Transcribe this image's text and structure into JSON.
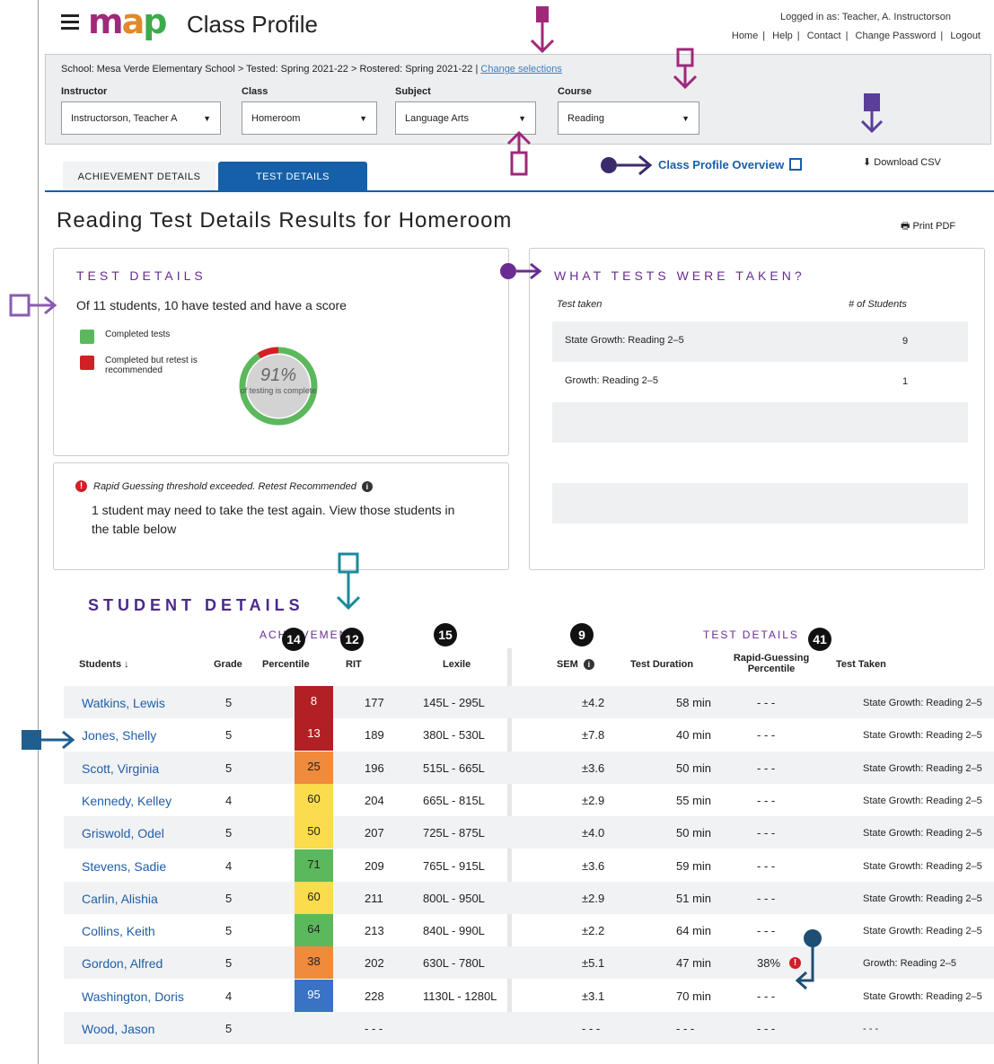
{
  "header": {
    "logo_text": "map",
    "app_title": "Class Profile",
    "logged_in": "Logged in as: Teacher, A. Instructorson",
    "nav": [
      "Home",
      "Help",
      "Contact",
      "Change Password",
      "Logout"
    ]
  },
  "filters": {
    "breadcrumb": "School: Mesa Verde Elementary School > Tested: Spring 2021-22 > Rostered: Spring 2021-22 |",
    "change_link": "Change selections",
    "instructor": {
      "label": "Instructor",
      "value": "Instructorson, Teacher A"
    },
    "class": {
      "label": "Class",
      "value": "Homeroom"
    },
    "subject": {
      "label": "Subject",
      "value": "Language Arts"
    },
    "course": {
      "label": "Course",
      "value": "Reading"
    }
  },
  "tabs": {
    "achievement": "ACHIEVEMENT DETAILS",
    "test": "TEST DETAILS"
  },
  "links": {
    "overview": "Class Profile Overview",
    "download": "Download CSV",
    "print": "Print PDF"
  },
  "page_title": "Reading Test Details Results for Homeroom",
  "test_details": {
    "heading": "TEST DETAILS",
    "summary": "Of 11 students, 10 have tested and have a score",
    "legend_completed": "Completed tests",
    "legend_retest": "Completed but retest is recommended",
    "percent": "91%",
    "percent_value": 91,
    "retest_fraction": 0.09,
    "percent_caption": "of testing is complete",
    "colors": {
      "completed": "#5cb85c",
      "retest": "#d21f26"
    }
  },
  "rapid_guessing": {
    "warning": "Rapid Guessing threshold exceeded. Retest Recommended",
    "message": "1 student may need to take the test again. View those students in the table below"
  },
  "tests_taken": {
    "heading": "WHAT TESTS WERE TAKEN?",
    "col_test": "Test taken",
    "col_count": "# of Students",
    "rows": [
      {
        "test": "State Growth: Reading 2–5",
        "count": "9"
      },
      {
        "test": "Growth: Reading 2–5",
        "count": "1"
      }
    ]
  },
  "student_details": {
    "heading": "STUDENT DETAILS",
    "group_achievement": "ACHIEVEMENT",
    "group_test": "TEST DETAILS",
    "columns": {
      "students": "Students ↓",
      "grade": "Grade",
      "percentile": "Percentile",
      "rit": "RIT",
      "lexile": "Lexile",
      "sem": "SEM",
      "duration": "Test Duration",
      "rapid": "Rapid-Guessing Percentile",
      "taken": "Test Taken"
    },
    "rows": [
      {
        "name": "Watkins, Lewis",
        "grade": "5",
        "percentile": "8",
        "pcolor": "#b22024",
        "rit": "177",
        "lexile": "145L - 295L",
        "sem": "±4.2",
        "duration": "58 min",
        "rapid": "- - -",
        "taken": "State Growth: Reading 2–5"
      },
      {
        "name": "Jones, Shelly",
        "grade": "5",
        "percentile": "13",
        "pcolor": "#b22024",
        "rit": "189",
        "lexile": "380L - 530L",
        "sem": "±7.8",
        "duration": "40 min",
        "rapid": "- - -",
        "taken": "State Growth: Reading 2–5"
      },
      {
        "name": "Scott, Virginia",
        "grade": "5",
        "percentile": "25",
        "pcolor": "#f08a3c",
        "rit": "196",
        "lexile": "515L - 665L",
        "sem": "±3.6",
        "duration": "50 min",
        "rapid": "- - -",
        "taken": "State Growth: Reading 2–5"
      },
      {
        "name": "Kennedy, Kelley",
        "grade": "4",
        "percentile": "60",
        "pcolor": "#fbdc4c",
        "rit": "204",
        "lexile": "665L - 815L",
        "sem": "±2.9",
        "duration": "55 min",
        "rapid": "- - -",
        "taken": "State Growth: Reading 2–5"
      },
      {
        "name": "Griswold, Odel",
        "grade": "5",
        "percentile": "50",
        "pcolor": "#fbdc4c",
        "rit": "207",
        "lexile": "725L - 875L",
        "sem": "±4.0",
        "duration": "50 min",
        "rapid": "- - -",
        "taken": "State Growth: Reading 2–5"
      },
      {
        "name": "Stevens, Sadie",
        "grade": "4",
        "percentile": "71",
        "pcolor": "#5cb85c",
        "rit": "209",
        "lexile": "765L - 915L",
        "sem": "±3.6",
        "duration": "59 min",
        "rapid": "- - -",
        "taken": "State Growth: Reading 2–5"
      },
      {
        "name": "Carlin, Alishia",
        "grade": "5",
        "percentile": "60",
        "pcolor": "#fbdc4c",
        "rit": "211",
        "lexile": "800L - 950L",
        "sem": "±2.9",
        "duration": "51 min",
        "rapid": "- - -",
        "taken": "State Growth: Reading 2–5"
      },
      {
        "name": "Collins, Keith",
        "grade": "5",
        "percentile": "64",
        "pcolor": "#5cb85c",
        "rit": "213",
        "lexile": "840L - 990L",
        "sem": "±2.2",
        "duration": "64 min",
        "rapid": "- - -",
        "taken": "State Growth: Reading 2–5"
      },
      {
        "name": "Gordon, Alfred",
        "grade": "5",
        "percentile": "38",
        "pcolor": "#f08a3c",
        "rit": "202",
        "lexile": "630L - 780L",
        "sem": "±5.1",
        "duration": "47 min",
        "rapid": "38%",
        "taken": "Growth: Reading 2–5"
      },
      {
        "name": "Washington, Doris",
        "grade": "4",
        "percentile": "95",
        "pcolor": "#3a72c4",
        "rit": "228",
        "lexile": "1130L - 1280L",
        "sem": "±3.1",
        "duration": "70 min",
        "rapid": "- - -",
        "taken": "State Growth: Reading 2–5"
      },
      {
        "name": "Wood, Jason",
        "grade": "5",
        "percentile": "",
        "pcolor": "",
        "rit": "- - -",
        "lexile": "",
        "sem": "- - -",
        "duration": "- - -",
        "rapid": "- - -",
        "taken": "- - -"
      }
    ]
  },
  "annotation_badges": {
    "b14": "14",
    "b12": "12",
    "b15": "15",
    "b9": "9",
    "b41": "41"
  }
}
